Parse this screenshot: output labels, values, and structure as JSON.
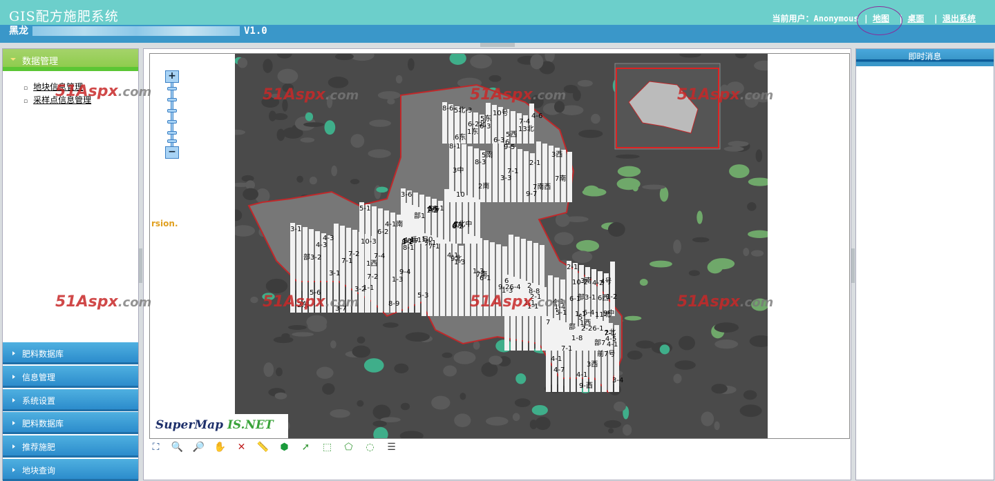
{
  "header": {
    "title": "GIS配方施肥系统",
    "subtitle_prefix": "黑龙",
    "version": "V1.0",
    "user_label": "当前用户：",
    "user_name": "Anonymous",
    "links": [
      "地图",
      "桌面",
      "退出系统"
    ],
    "separator": "|"
  },
  "sidebar": {
    "section": "数据管理",
    "sub_items": [
      "地块信息管理",
      "采样点信息管理"
    ],
    "accordion": [
      "肥料数据库",
      "信息管理",
      "系统设置",
      "肥料数据库",
      "推荐施肥",
      "地块查询"
    ]
  },
  "map": {
    "version_text": "rsion.",
    "logo_main": "SuperMap",
    "logo_sub": "IS.NET",
    "watermark": "51Aspx",
    "watermark_suffix": ".com",
    "parcel_labels": [
      "8-6",
      "8-1",
      "3-6",
      "5-1",
      "3-1",
      "1-0",
      "6",
      "7",
      "2-1",
      "6-2北",
      "8-3",
      "1-2",
      "4-1南",
      "4-3",
      "4-1",
      "2-1",
      "1-8",
      "4-2",
      "6-3",
      "3-3",
      "6-2",
      "后1号",
      "7-1",
      "1-3",
      "5-1",
      "前7号",
      "6-1",
      "7-4",
      "9-7",
      "8-1",
      "7-4",
      "7-2",
      "9-26-4",
      "2-26-1",
      "4-7",
      "11北",
      "6东",
      "3西",
      "7西",
      "9-4",
      "5-6",
      "1-1",
      "4-1",
      "9-西",
      "10-2",
      "5东",
      "3中",
      "8东",
      "1-1",
      "3-7",
      "外1",
      "8-8",
      "2北",
      "6西",
      "5西",
      "2南",
      "1-2",
      "8-9",
      "10-3",
      "9北",
      "1-4",
      "7-1",
      "1-1",
      "4-6",
      "9-5",
      "3-6",
      "部1",
      "部3-2",
      "7南",
      "1西",
      "3西",
      "4号",
      "1东",
      "2-1",
      "5",
      "6-2",
      "3-1",
      "1-3",
      "4-5",
      "3-4",
      "部3-1",
      "10号",
      "7南",
      "10中",
      "8-1",
      "3-2",
      "1-1",
      "2",
      "部",
      "9中",
      "13北",
      "10",
      "56-1",
      "1西",
      "2东",
      "7-1",
      "4-1",
      "部7",
      "3南",
      "5北-3",
      "5南",
      "7北中",
      "1-3",
      "4-3",
      "1-3",
      "5",
      "4-1",
      "1-2",
      "6-3",
      "7-1",
      "4-1",
      "5-3",
      "7-2",
      "6-1",
      "7-1",
      "4-1",
      "6-4",
      "6",
      "7南西"
    ]
  },
  "toolbar": {
    "tools": [
      "full-extent",
      "zoom-in",
      "zoom-out",
      "pan",
      "clear",
      "measure",
      "identify",
      "select-point",
      "select-rect",
      "select-polygon",
      "select-circle",
      "layers"
    ]
  },
  "right_panel": {
    "title": "即时消息"
  },
  "colors": {
    "header_top": "#6ccfcb",
    "header_band": "#3a97c9",
    "sidebar_active": "#8fcc4e",
    "accordion": "#2c8ccc",
    "outline": "#c0282a"
  }
}
